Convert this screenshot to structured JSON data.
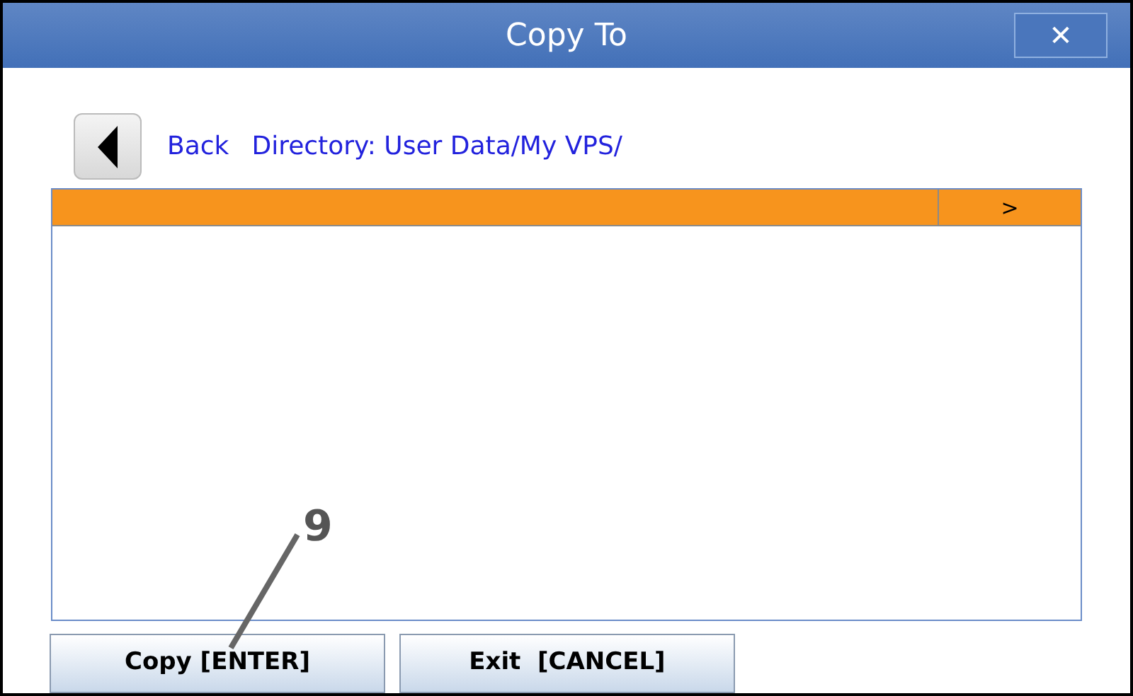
{
  "window": {
    "title": "Copy To",
    "close": "✕"
  },
  "nav": {
    "back_label": "Back",
    "directory": "Directory: User Data/My VPS/"
  },
  "table": {
    "columns": [
      "",
      ">"
    ]
  },
  "buttons": [
    "Copy [ENTER]",
    "Exit  [CANCEL]"
  ],
  "callout": {
    "label": "9"
  }
}
